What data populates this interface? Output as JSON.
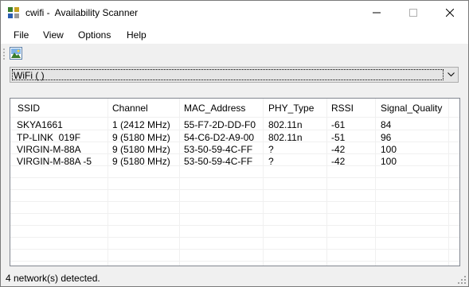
{
  "window": {
    "title": "cwifi -  Availability Scanner"
  },
  "menu": [
    "File",
    "View",
    "Options",
    "Help"
  ],
  "toolbar": {
    "scan_icon": "scan-icon"
  },
  "adapter_select": {
    "value": "WiFi ( )"
  },
  "table": {
    "columns": [
      "SSID",
      "Channel",
      "MAC_Address",
      "PHY_Type",
      "RSSI",
      "Signal_Quality"
    ],
    "rows": [
      [
        "SKYA1661",
        "1 (2412 MHz)",
        "55-F7-2D-DD-F0",
        "802.11n",
        "-61",
        "84"
      ],
      [
        "TP-LINK  019F",
        "9 (5180 MHz)",
        "54-C6-D2-A9-00",
        "802.11n",
        "-51",
        "96"
      ],
      [
        "VIRGIN-M-88A",
        "9 (5180 MHz)",
        "53-50-59-4C-FF",
        "?",
        "-42",
        "100"
      ],
      [
        "VIRGIN-M-88A -5",
        "9 (5180 MHz)",
        "53-50-59-4C-FF",
        "?",
        "-42",
        "100"
      ]
    ]
  },
  "status": {
    "text": "4 network(s) detected."
  }
}
